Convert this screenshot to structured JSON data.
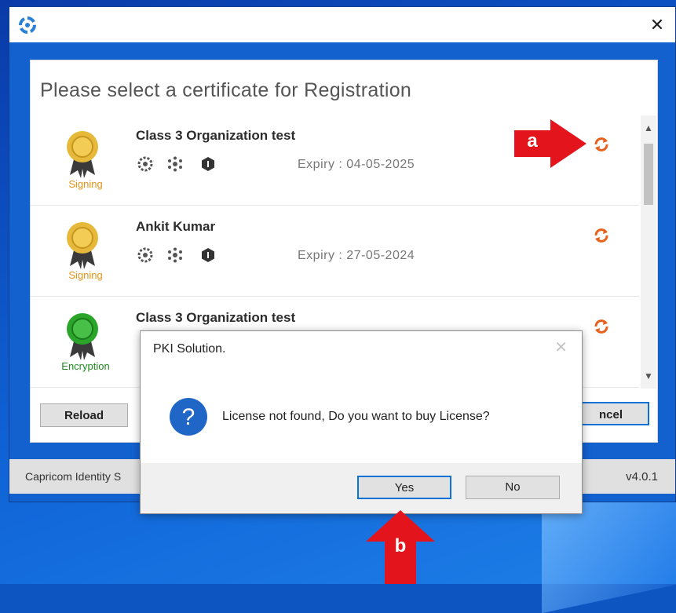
{
  "heading": "Please select a certificate for Registration",
  "certificates": [
    {
      "name": "Class 3 Organization test",
      "type": "Signing",
      "expiry": "Expiry : 04-05-2025"
    },
    {
      "name": "Ankit Kumar",
      "type": "Signing",
      "expiry": "Expiry : 27-05-2024"
    },
    {
      "name": "Class 3 Organization test",
      "type": "Encryption",
      "expiry": ""
    }
  ],
  "buttons": {
    "reload": "Reload",
    "cancel": "ncel"
  },
  "statusbar": {
    "left": "Capricom Identity S",
    "version": "v4.0.1"
  },
  "dialog": {
    "title": "PKI Solution.",
    "message": "License not found, Do you want to buy License?",
    "yes": "Yes",
    "no": "No"
  },
  "callouts": {
    "a": "a",
    "b": "b"
  },
  "colors": {
    "signing": "#e69319",
    "encryption": "#1f8a1f",
    "refresh": "#e8611b",
    "arrow": "#e3141b",
    "accent": "#0a72d4",
    "titlebar_bg": "#1261cf"
  },
  "icons": {
    "cert_actions": [
      "gear-icon",
      "dots-icon",
      "hexagon-icon"
    ],
    "row_action": "refresh-icon"
  }
}
